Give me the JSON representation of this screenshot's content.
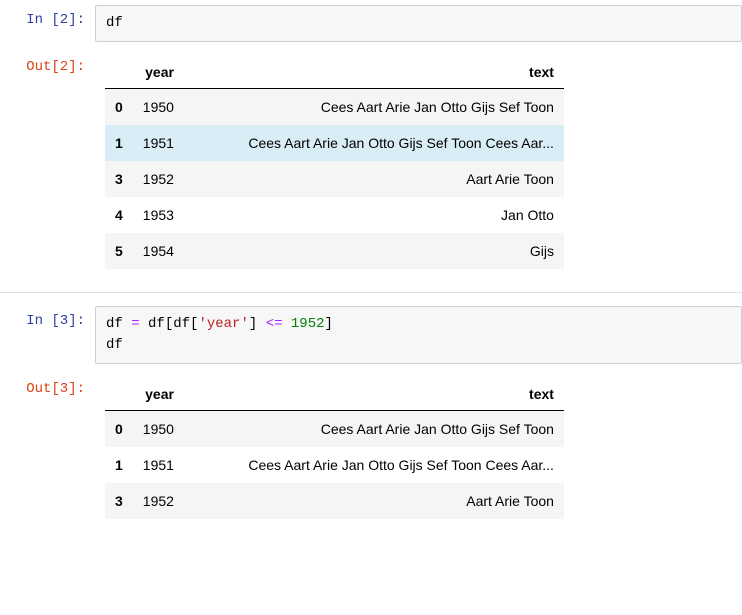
{
  "cells": {
    "c2": {
      "in_prompt": "In [2]:",
      "out_prompt": "Out[2]:",
      "code_html": "<span class=\"tk-var\">df</span>",
      "table": {
        "columns": [
          "year",
          "text"
        ],
        "rows": [
          {
            "idx": "0",
            "year": "1950",
            "text": "Cees Aart Arie Jan Otto Gijs Sef Toon",
            "hover": false
          },
          {
            "idx": "1",
            "year": "1951",
            "text": "Cees Aart Arie Jan Otto Gijs Sef Toon Cees Aar...",
            "hover": true
          },
          {
            "idx": "3",
            "year": "1952",
            "text": "Aart Arie Toon",
            "hover": false
          },
          {
            "idx": "4",
            "year": "1953",
            "text": "Jan Otto",
            "hover": false
          },
          {
            "idx": "5",
            "year": "1954",
            "text": "Gijs",
            "hover": false
          }
        ]
      }
    },
    "c3": {
      "in_prompt": "In [3]:",
      "out_prompt": "Out[3]:",
      "code_html": "<span class=\"tk-var\">df</span> <span class=\"tk-op\">=</span> <span class=\"tk-var\">df[df[</span><span class=\"tk-str\">'year'</span><span class=\"tk-var\">]</span> <span class=\"tk-op\">&lt;=</span> <span class=\"tk-num\">1952</span><span class=\"tk-var\">]</span>\n<span class=\"tk-var\">df</span>",
      "table": {
        "columns": [
          "year",
          "text"
        ],
        "rows": [
          {
            "idx": "0",
            "year": "1950",
            "text": "Cees Aart Arie Jan Otto Gijs Sef Toon",
            "hover": false
          },
          {
            "idx": "1",
            "year": "1951",
            "text": "Cees Aart Arie Jan Otto Gijs Sef Toon Cees Aar...",
            "hover": false
          },
          {
            "idx": "3",
            "year": "1952",
            "text": "Aart Arie Toon",
            "hover": false
          }
        ]
      }
    }
  }
}
